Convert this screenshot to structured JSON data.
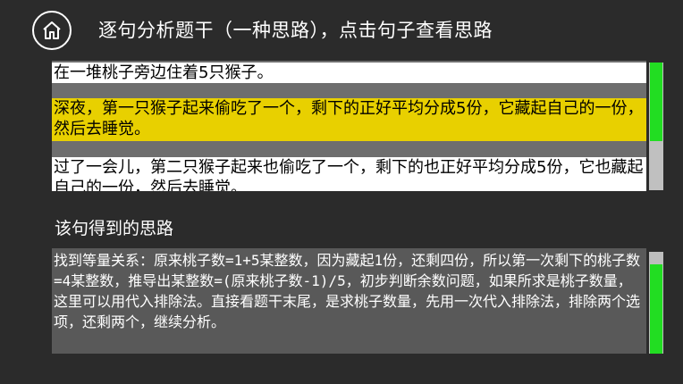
{
  "header": {
    "home_icon": "home-icon",
    "title": "逐句分析题干（一种思路），点击句子查看思路"
  },
  "sentences": [
    {
      "text": "在一堆桃子旁边住着5只猴子。",
      "selected": false
    },
    {
      "text": "深夜，第一只猴子起来偷吃了一个，剩下的正好平均分成5份，它藏起自己的一份，然后去睡觉。",
      "selected": true
    },
    {
      "text": "过了一会儿，第二只猴子起来也偷吃了一个，剩下的也正好平均分成5份，它也藏起自己的一份，然后去睡觉。",
      "selected": false
    }
  ],
  "section_label": "该句得到的思路",
  "analysis_text": "找到等量关系：原来桃子数=1+5某整数，因为藏起1份，还剩四份，所以第一次剩下的桃子数=4某整数，推导出某整数=(原来桃子数-1)/5，初步判断余数问题，如果所求是桃子数量，这里可以用代入排除法。直接看题干末尾，是求桃子数量，先用一次代入排除法，排除两个选项，还剩两个，继续分析。",
  "colors": {
    "background": "#2b2b2b",
    "highlight": "#e8d000",
    "scroll_thumb": "#22dd22"
  }
}
